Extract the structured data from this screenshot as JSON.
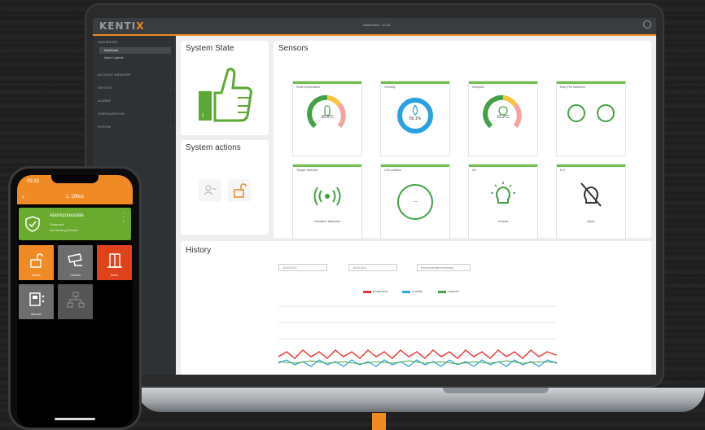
{
  "desktop": {
    "logo": "KENTIX",
    "topbar_center": "Dashboard   ◦  12:43",
    "sidebar": {
      "groups": [
        {
          "label": "DASHBOARD",
          "children": [
            {
              "label": "Dashboard",
              "active": true
            },
            {
              "label": "Alarm Logbook",
              "active": false
            }
          ]
        },
        {
          "label": "ACCOUNT MANAGER",
          "children": []
        },
        {
          "label": "DEVICES",
          "children": []
        },
        {
          "label": "ALARMS",
          "children": []
        },
        {
          "label": "CONFIGURATION",
          "children": []
        },
        {
          "label": "SYSTEM",
          "children": []
        }
      ]
    },
    "system_state": {
      "title": "System State"
    },
    "system_actions": {
      "title": "System actions"
    },
    "sensors": {
      "title": "Sensors",
      "cards": [
        {
          "title": "Room temperature",
          "value": "26.3°C",
          "type": "gauge-color"
        },
        {
          "title": "Humidity",
          "value": "50.1%",
          "type": "gauge-blue"
        },
        {
          "title": "Dewpoint",
          "value": "15.2°C",
          "type": "gauge-color"
        },
        {
          "title": "Early Fire Detection",
          "value": "",
          "type": "dual"
        },
        {
          "title": "Tamper detection",
          "value": "Vibration detected",
          "type": "vibration"
        },
        {
          "title": "CO2 pollution",
          "value": "---",
          "type": "ring"
        },
        {
          "title": "DI1",
          "value": "Closed",
          "type": "bulb"
        },
        {
          "title": "DI 2",
          "value": "Open",
          "type": "door"
        }
      ]
    },
    "history": {
      "title": "History",
      "from": "15.03.2021",
      "to": "16.03.2021",
      "select": "Environmental monitoring",
      "legend": [
        {
          "name": "temperature",
          "color": "#e53935"
        },
        {
          "name": "humidity",
          "color": "#29a3e0"
        },
        {
          "name": "dewpoint",
          "color": "#43a047"
        }
      ]
    }
  },
  "phone": {
    "time": "09:33",
    "title": "1. Office",
    "alarm": {
      "title": "Alarmzonestate",
      "line1": "Disarmed",
      "line2": "via Sensing Service"
    },
    "tiles": [
      {
        "label": "Disarm",
        "color": "#f08a24",
        "icon": "lock-icon"
      },
      {
        "label": "Camera",
        "color": "#6d6d6d",
        "icon": "camera-icon"
      },
      {
        "label": "Doors",
        "color": "#e0431b",
        "icon": "door-icon"
      },
      {
        "label": "Sensors",
        "color": "#6d6d6d",
        "icon": "sensor-icon"
      },
      {
        "label": "",
        "color": "#555555",
        "icon": "network-icon"
      }
    ]
  }
}
